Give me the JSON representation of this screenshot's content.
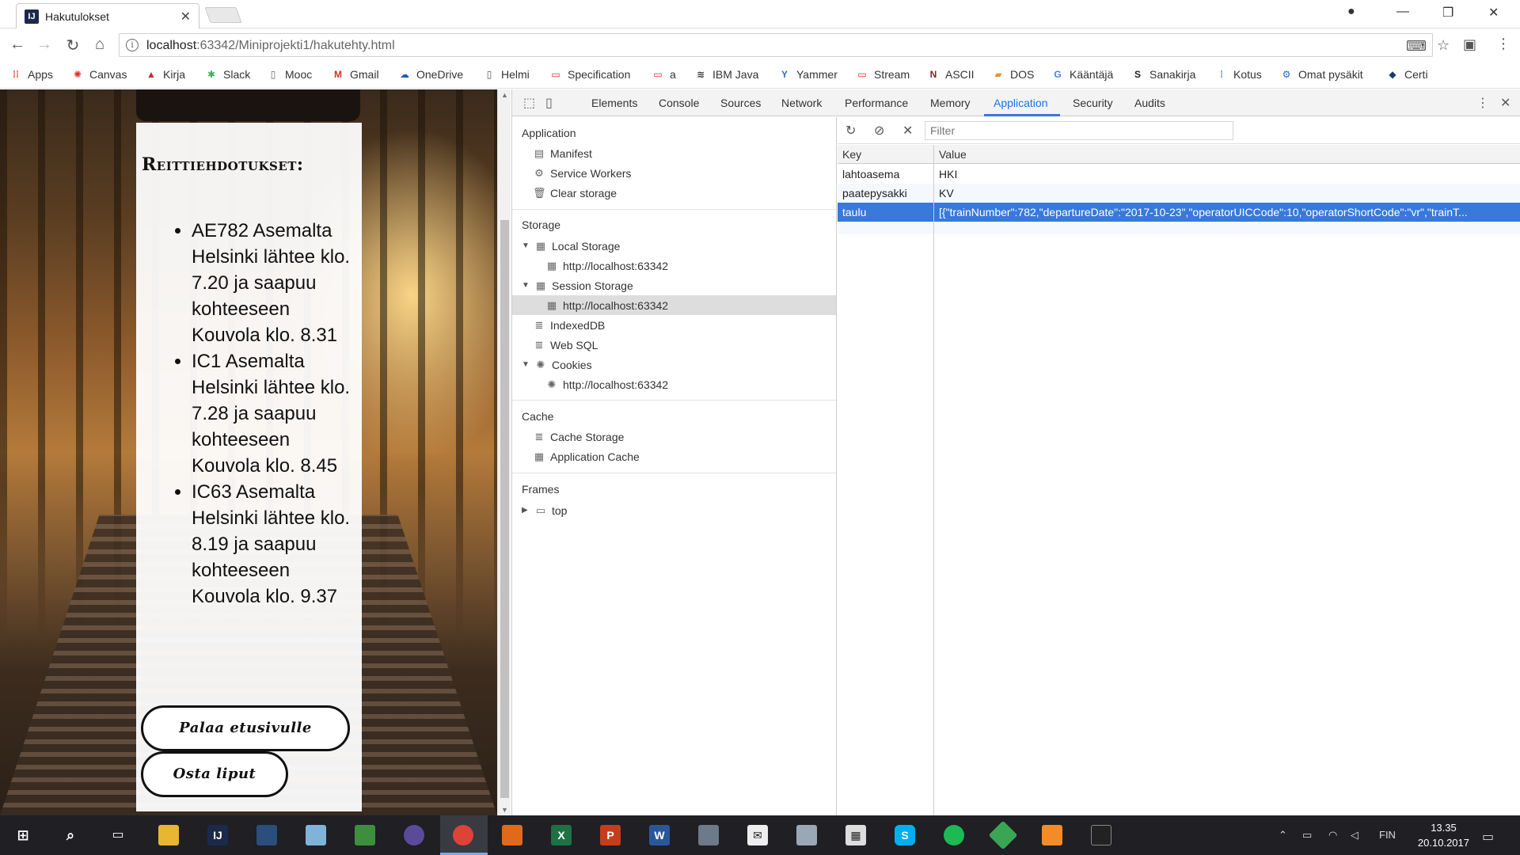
{
  "browser": {
    "tab_title": "Hakutulokset",
    "tab_favicon": "IJ",
    "url_host": "localhost",
    "url_path": ":63342/Miniprojekti1/hakutehty.html"
  },
  "bookmarks": [
    {
      "label": "Apps",
      "icon": "apps-grid-icon",
      "color": "#e8453c"
    },
    {
      "label": "Canvas",
      "icon": "canvas-icon",
      "color": "#e4312b"
    },
    {
      "label": "Kirja",
      "icon": "book-icon",
      "color": "#c22f2f"
    },
    {
      "label": "Slack",
      "icon": "slack-icon",
      "color": "#3fae5a"
    },
    {
      "label": "Mooc",
      "icon": "page-icon",
      "color": "#666666"
    },
    {
      "label": "Gmail",
      "icon": "gmail-icon",
      "color": "#d93025"
    },
    {
      "label": "OneDrive",
      "icon": "onedrive-icon",
      "color": "#1a5fb4"
    },
    {
      "label": "Helmi",
      "icon": "page-icon",
      "color": "#555555"
    },
    {
      "label": "Specification",
      "icon": "oracle-icon",
      "color": "#e52b2b"
    },
    {
      "label": "a",
      "icon": "oracle-icon",
      "color": "#e52b2b"
    },
    {
      "label": "IBM Java",
      "icon": "ibm-icon",
      "color": "#333333"
    },
    {
      "label": "Yammer",
      "icon": "yammer-icon",
      "color": "#396acc"
    },
    {
      "label": "Stream",
      "icon": "oracle-icon",
      "color": "#e52b2b"
    },
    {
      "label": "ASCII",
      "icon": "ascii-icon",
      "color": "#9a1c1c"
    },
    {
      "label": "DOS",
      "icon": "folder-icon",
      "color": "#d89c2a"
    },
    {
      "label": "Kääntäjä",
      "icon": "translate-icon",
      "color": "#4a7ef0"
    },
    {
      "label": "Sanakirja",
      "icon": "sanakirja-icon",
      "color": "#222222"
    },
    {
      "label": "Kotus",
      "icon": "kotus-icon",
      "color": "#6b8cc6"
    },
    {
      "label": "Omat pysäkit",
      "icon": "gear-icon",
      "color": "#2b66c0"
    },
    {
      "label": "Certi",
      "icon": "certi-icon",
      "color": "#1f3a6a"
    }
  ],
  "page": {
    "heading": "Reittiehdotukset:",
    "routes": [
      "AE782 Asemalta Helsinki lähtee klo. 7.20 ja saapuu kohteeseen Kouvola klo. 8.31",
      "IC1 Asemalta Helsinki lähtee klo. 7.28 ja saapuu kohteeseen Kouvola klo. 8.45",
      "IC63 Asemalta Helsinki lähtee klo. 8.19 ja saapuu kohteeseen Kouvola klo. 9.37"
    ],
    "back_button": "Palaa etusivulle",
    "buy_button": "Osta liput"
  },
  "devtools": {
    "tabs": [
      "Elements",
      "Console",
      "Sources",
      "Network",
      "Performance",
      "Memory",
      "Application",
      "Security",
      "Audits"
    ],
    "active_tab": "Application",
    "sidebar": {
      "application_title": "Application",
      "application_items": [
        "Manifest",
        "Service Workers",
        "Clear storage"
      ],
      "storage_title": "Storage",
      "local_storage": "Local Storage",
      "local_storage_origin": "http://localhost:63342",
      "session_storage": "Session Storage",
      "session_storage_origin": "http://localhost:63342",
      "indexeddb": "IndexedDB",
      "websql": "Web SQL",
      "cookies": "Cookies",
      "cookies_origin": "http://localhost:63342",
      "cache_title": "Cache",
      "cache_items": [
        "Cache Storage",
        "Application Cache"
      ],
      "frames_title": "Frames",
      "frames_top": "top"
    },
    "filter_placeholder": "Filter",
    "grid": {
      "key_header": "Key",
      "value_header": "Value",
      "rows": [
        {
          "key": "lahtoasema",
          "value": "HKI"
        },
        {
          "key": "paatepysakki",
          "value": "KV"
        },
        {
          "key": "taulu",
          "value": "[{\"trainNumber\":782,\"departureDate\":\"2017-10-23\",\"operatorUICCode\":10,\"operatorShortCode\":\"vr\",\"trainT..."
        }
      ],
      "selected_key": "taulu"
    }
  },
  "taskbar": {
    "language": "FIN",
    "time": "13.35",
    "date": "20.10.2017"
  }
}
